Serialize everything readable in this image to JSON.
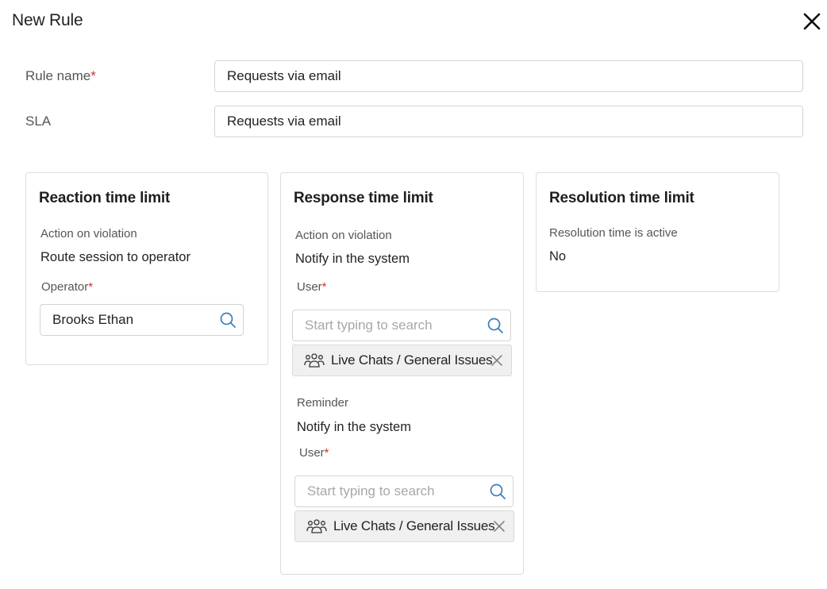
{
  "header": {
    "title": "New Rule",
    "close_icon": "close-icon"
  },
  "form": {
    "rule_name_label": "Rule name",
    "rule_name_value": "Requests via email",
    "sla_label": "SLA",
    "sla_value": "Requests via email",
    "required_mark": "*"
  },
  "reaction": {
    "title": "Reaction time limit",
    "action_label": "Action on violation",
    "action_value": "Route session to operator",
    "operator_label": "Operator",
    "operator_value": "Brooks Ethan"
  },
  "response": {
    "title": "Response time limit",
    "action_label": "Action on violation",
    "action_value": "Notify in the system",
    "user_label": "User",
    "user_search_placeholder": "Start typing to search",
    "user_chip": "Live Chats / General Issues",
    "reminder_label": "Reminder",
    "reminder_value": "Notify in the system",
    "reminder_user_label": "User",
    "reminder_search_placeholder": "Start typing to search",
    "reminder_chip": "Live Chats / General Issues"
  },
  "resolution": {
    "title": "Resolution time limit",
    "active_label": "Resolution time is active",
    "active_value": "No"
  },
  "colors": {
    "required": "#d32f2f",
    "icon": "#3a7bbf",
    "border": "#d4d4d4",
    "chip_bg": "#f0f0f0"
  }
}
